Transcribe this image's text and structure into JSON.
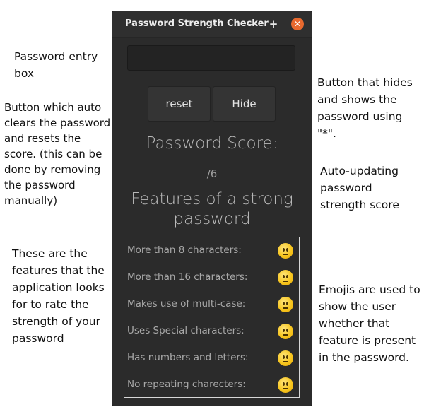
{
  "window": {
    "title": "Password Strength Checker",
    "minimize_glyph": "–",
    "maximize_glyph": "+",
    "close_glyph": "✕",
    "close_color": "#e8692e"
  },
  "password_input": {
    "value": "",
    "placeholder": ""
  },
  "buttons": {
    "reset_label": "reset",
    "hide_label": "Hide"
  },
  "score": {
    "title": "Password Score:",
    "value": "/6"
  },
  "features": {
    "heading": "Features of a strong password",
    "items": [
      {
        "label": "More than 8 characters:",
        "icon": "neutral-face-emoji-icon"
      },
      {
        "label": "More than 16 characters:",
        "icon": "neutral-face-emoji-icon"
      },
      {
        "label": "Makes use of multi-case:",
        "icon": "neutral-face-emoji-icon"
      },
      {
        "label": "Uses Special characters:",
        "icon": "neutral-face-emoji-icon"
      },
      {
        "label": "Has numbers and letters:",
        "icon": "neutral-face-emoji-icon"
      },
      {
        "label": "No repeating charecters:",
        "icon": "neutral-face-emoji-icon"
      }
    ]
  },
  "annotations": {
    "entry_box": "Password entry box",
    "reset_button": "Button which auto clears the password and resets the score. (this can be done by removing the password manually)",
    "hide_button": "Button that hides and shows the password using \"*\".",
    "score": "Auto-updating password strength score",
    "features": "These are the features that the application looks for to rate the strength of your password",
    "emojis": "Emojis are used to show the user whether that feature is present in the password."
  }
}
